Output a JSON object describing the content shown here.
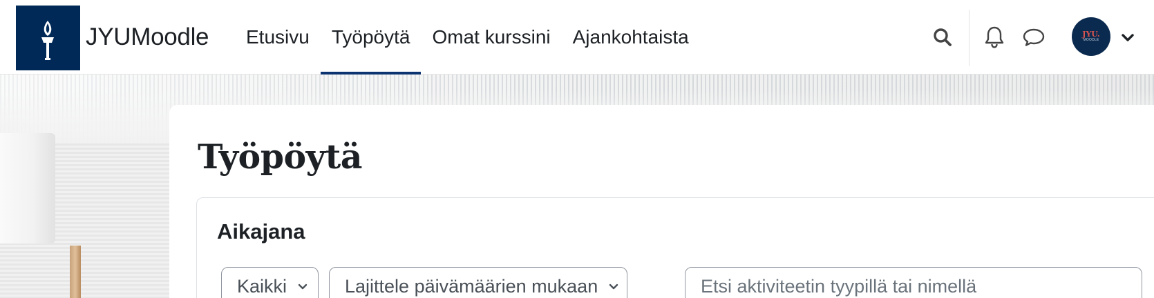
{
  "header": {
    "site_name": "JYUMoodle",
    "nav_items": [
      {
        "label": "Etusivu",
        "active": false
      },
      {
        "label": "Työpöytä",
        "active": true
      },
      {
        "label": "Omat kurssini",
        "active": false
      },
      {
        "label": "Ajankohtaista",
        "active": false
      }
    ],
    "icons": [
      "search-icon",
      "bell-icon",
      "chat-icon",
      "chevron-down-icon"
    ],
    "avatar": {
      "line1": "JYU.",
      "line2": "MOODLE"
    }
  },
  "main": {
    "page_title": "Työpöytä",
    "timeline": {
      "title": "Aikajana",
      "filter_label": "Kaikki",
      "sort_label": "Lajittele päivämäärien mukaan",
      "search_placeholder": "Etsi aktiviteetin tyypillä tai nimellä"
    }
  },
  "colors": {
    "brand_navy": "#002957",
    "active_underline": "#0b3470",
    "text": "#1d2125",
    "border": "#8f959e"
  }
}
